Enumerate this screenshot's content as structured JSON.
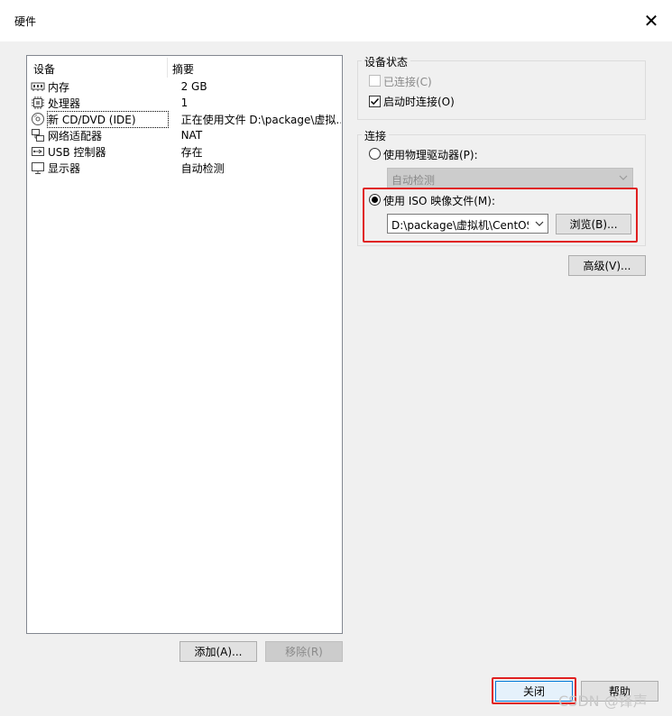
{
  "window": {
    "title": "硬件",
    "close_glyph": "✕"
  },
  "device_list": {
    "columns": {
      "device": "设备",
      "summary": "摘要"
    },
    "rows": [
      {
        "name": "内存",
        "summary": "2 GB",
        "icon": "memory-icon"
      },
      {
        "name": "处理器",
        "summary": "1",
        "icon": "cpu-icon"
      },
      {
        "name": "新 CD/DVD (IDE)",
        "summary": "正在使用文件 D:\\package\\虚拟...",
        "icon": "cd-dvd-icon"
      },
      {
        "name": "网络适配器",
        "summary": "NAT",
        "icon": "network-adapter-icon"
      },
      {
        "name": "USB 控制器",
        "summary": "存在",
        "icon": "usb-icon"
      },
      {
        "name": "显示器",
        "summary": "自动检测",
        "icon": "monitor-icon"
      }
    ],
    "selected_index": 2
  },
  "buttons": {
    "add": "添加(A)...",
    "remove": "移除(R)",
    "close": "关闭",
    "help": "帮助",
    "browse": "浏览(B)...",
    "advanced": "高级(V)..."
  },
  "device_status": {
    "title": "设备状态",
    "connected_label": "已连接(C)",
    "connected_checked": false,
    "connected_enabled": false,
    "connect_at_power_on_label": "启动时连接(O)",
    "connect_at_power_on_checked": true
  },
  "connection": {
    "title": "连接",
    "physical_drive_label": "使用物理驱动器(P):",
    "physical_drive_selected": false,
    "physical_drive_value": "自动检测",
    "iso_label": "使用 ISO 映像文件(M):",
    "iso_selected": true,
    "iso_path": "D:\\package\\虚拟机\\CentOS-"
  },
  "watermark": "CSDN @锋声",
  "colors": {
    "highlight": "#e02020",
    "window_bg": "#f0f0f0"
  }
}
